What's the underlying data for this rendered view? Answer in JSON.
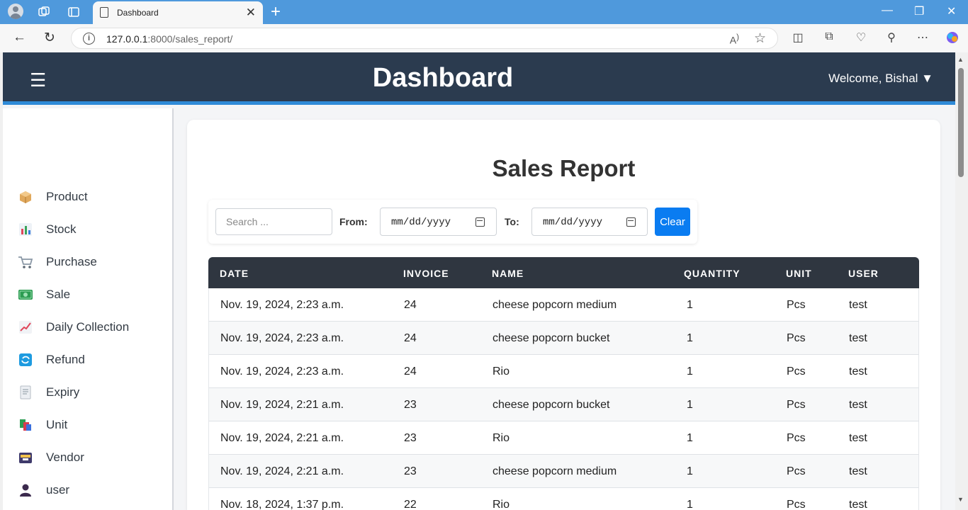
{
  "browser": {
    "tab_title": "Dashboard",
    "url_host": "127.0.0.1",
    "url_rest": ":8000/sales_report/"
  },
  "header": {
    "menu_icon": "☰",
    "brand": "Dashboard",
    "welcome": "Welcome, Bishal ▼"
  },
  "sidebar": {
    "items": [
      {
        "label": "Product",
        "icon": "package-icon"
      },
      {
        "label": "Stock",
        "icon": "bar-chart-icon"
      },
      {
        "label": "Purchase",
        "icon": "shopping-cart-icon"
      },
      {
        "label": "Sale",
        "icon": "money-icon"
      },
      {
        "label": "Daily Collection",
        "icon": "trend-chart-icon"
      },
      {
        "label": "Refund",
        "icon": "refresh-icon"
      },
      {
        "label": "Expiry",
        "icon": "receipt-icon"
      },
      {
        "label": "Unit",
        "icon": "books-icon"
      },
      {
        "label": "Vendor",
        "icon": "cardbox-icon"
      },
      {
        "label": "user",
        "icon": "user-icon"
      }
    ]
  },
  "report": {
    "title": "Sales Report",
    "search_placeholder": "Search ...",
    "from_label": "From:",
    "to_label": "To:",
    "date_placeholder": "mm/dd/yyyy",
    "clear_label": "Clear"
  },
  "table": {
    "headers": [
      "DATE",
      "INVOICE",
      "NAME",
      "QUANTITY",
      "UNIT",
      "USER"
    ],
    "rows": [
      [
        "Nov. 19, 2024, 2:23 a.m.",
        "24",
        "cheese popcorn medium",
        "1",
        "Pcs",
        "test"
      ],
      [
        "Nov. 19, 2024, 2:23 a.m.",
        "24",
        "cheese popcorn bucket",
        "1",
        "Pcs",
        "test"
      ],
      [
        "Nov. 19, 2024, 2:23 a.m.",
        "24",
        "Rio",
        "1",
        "Pcs",
        "test"
      ],
      [
        "Nov. 19, 2024, 2:21 a.m.",
        "23",
        "cheese popcorn bucket",
        "1",
        "Pcs",
        "test"
      ],
      [
        "Nov. 19, 2024, 2:21 a.m.",
        "23",
        "Rio",
        "1",
        "Pcs",
        "test"
      ],
      [
        "Nov. 19, 2024, 2:21 a.m.",
        "23",
        "cheese popcorn medium",
        "1",
        "Pcs",
        "test"
      ],
      [
        "Nov. 18, 2024, 1:37 p.m.",
        "22",
        "Rio",
        "1",
        "Pcs",
        "test"
      ]
    ]
  }
}
